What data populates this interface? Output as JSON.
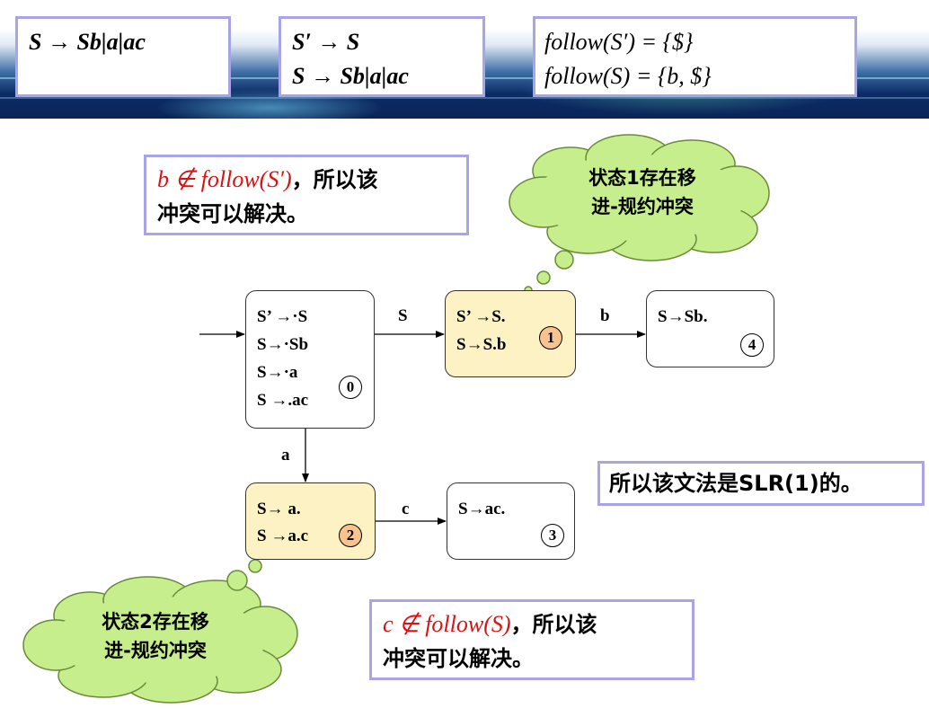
{
  "header": {
    "grammar": "S → Sb|a|ac",
    "augmented": [
      "S′ → S",
      "S → Sb|a|ac"
    ],
    "follow": [
      "follow(S′) = {$}",
      "follow(S) = {b, $}"
    ]
  },
  "notes": {
    "top": {
      "math": "b ∉ follow(S′)",
      "line1_rest": "，所以该",
      "line2": "冲突可以解决。"
    },
    "bottom": {
      "math": "c ∉ follow(S)",
      "line1_rest": "，所以该",
      "line2": "冲突可以解决。"
    },
    "conclusion": "所以该文法是SLR(1)的。"
  },
  "clouds": {
    "top": [
      "状态1存在移",
      "进-规约冲突"
    ],
    "bottom": [
      "状态2存在移",
      "进-规约冲突"
    ]
  },
  "states": [
    {
      "id": "0",
      "items": [
        "S’ →·S",
        "S→·Sb",
        "S→·a",
        "S →.ac"
      ]
    },
    {
      "id": "1",
      "items": [
        "S’ →S.",
        "S→S.b"
      ]
    },
    {
      "id": "2",
      "items": [
        "S→ a.",
        "S →a.c"
      ]
    },
    {
      "id": "3",
      "items": [
        "S→ac."
      ]
    },
    {
      "id": "4",
      "items": [
        "S→Sb."
      ]
    }
  ],
  "edges": [
    {
      "from": "0",
      "to": "1",
      "label": "S"
    },
    {
      "from": "1",
      "to": "4",
      "label": "b"
    },
    {
      "from": "0",
      "to": "2",
      "label": "a"
    },
    {
      "from": "2",
      "to": "3",
      "label": "c"
    }
  ],
  "colors": {
    "box_border": "#a9a3e8",
    "highlight_state": "#fcf2c4",
    "state_number_fill": "#f8c38f",
    "cloud_fill": "#c6ee8c",
    "math_red": "#d11111"
  }
}
